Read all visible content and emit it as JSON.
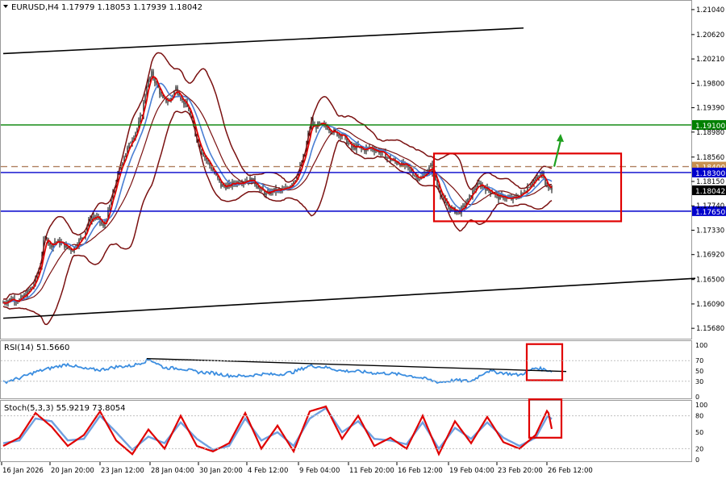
{
  "header": {
    "symbol_label": "EURUSD,H4",
    "ohlc": "1.17979 1.18053 1.17939 1.18042"
  },
  "colors": {
    "candle": "#000000",
    "bb": "#7a1010",
    "ma_fast": "#e00000",
    "ma_slow": "#4a7fd4",
    "trend": "#000000",
    "hline_blue": "#0000cc",
    "hline_green": "#008000",
    "hline_dashed": "#b08060",
    "rect": "#e00000",
    "arrow": "#1fa01f",
    "rsi": "#3c8ee0",
    "stoch_main": "#e00000",
    "stoch_signal": "#6fa0e0",
    "price_badge_bg": "#000000",
    "blue_badge_bg": "#0000cc",
    "green_badge_bg": "#008000",
    "orange_badge_bg": "#c89050"
  },
  "chart_data": [
    {
      "type": "line",
      "panel": "price",
      "title": "EURUSD,H4",
      "ylim": [
        1.1556,
        1.2112
      ],
      "y_ticks": [
        "1.21040",
        "1.20620",
        "1.20210",
        "1.19800",
        "1.19390",
        "1.18980",
        "1.18560",
        "1.18150",
        "1.17740",
        "1.17330",
        "1.16920",
        "1.16500",
        "1.16090",
        "1.15680"
      ],
      "x_labels": [
        "16 Jan 2026",
        "20 Jan 20:00",
        "23 Jan 12:00",
        "28 Jan 04:00",
        "30 Jan 20:00",
        "4 Feb 12:00",
        "9 Feb 04:00",
        "11 Feb 20:00",
        "16 Feb 12:00",
        "19 Feb 04:00",
        "23 Feb 20:00",
        "26 Feb 12:00"
      ],
      "close_anchor_x": [
        0,
        10,
        20,
        30,
        38,
        46,
        50,
        54,
        58,
        64,
        68,
        74,
        80,
        86,
        92,
        100,
        106,
        112,
        118,
        124,
        130,
        138,
        144,
        150,
        158,
        166,
        172,
        178,
        184,
        190,
        198,
        206,
        214,
        222,
        230,
        238,
        246,
        254,
        262,
        270,
        278,
        286,
        294,
        302,
        310,
        318,
        326,
        334,
        342,
        350,
        356,
        362,
        368,
        374,
        378,
        382,
        386,
        390,
        396,
        402,
        408,
        414,
        420,
        426,
        432,
        438,
        446,
        454,
        462,
        470,
        478,
        486,
        494,
        502,
        510,
        518,
        524,
        530,
        536,
        542,
        548,
        554,
        560,
        566,
        572,
        578,
        584,
        590,
        596,
        602,
        608,
        614,
        620,
        626,
        632,
        638,
        644,
        650,
        656,
        662,
        668,
        672,
        676,
        680
      ],
      "close_anchor_y": [
        1.1611,
        1.1618,
        1.1615,
        1.1628,
        1.1642,
        1.1675,
        1.1712,
        1.1722,
        1.1706,
        1.1714,
        1.1713,
        1.171,
        1.1703,
        1.17,
        1.1712,
        1.1725,
        1.1748,
        1.1756,
        1.1752,
        1.1738,
        1.1763,
        1.1805,
        1.1835,
        1.1858,
        1.1882,
        1.1904,
        1.193,
        1.1978,
        1.1996,
        1.1978,
        1.1952,
        1.195,
        1.1972,
        1.1952,
        1.1935,
        1.1895,
        1.1865,
        1.1847,
        1.1828,
        1.1808,
        1.1807,
        1.1812,
        1.1815,
        1.1818,
        1.1816,
        1.1803,
        1.1793,
        1.18,
        1.1799,
        1.1802,
        1.181,
        1.182,
        1.1838,
        1.1862,
        1.1893,
        1.1915,
        1.1905,
        1.191,
        1.1909,
        1.1906,
        1.19,
        1.1895,
        1.1895,
        1.1882,
        1.1872,
        1.1873,
        1.1868,
        1.1872,
        1.1868,
        1.1863,
        1.1853,
        1.1848,
        1.1844,
        1.1838,
        1.1826,
        1.182,
        1.183,
        1.184,
        1.1818,
        1.1795,
        1.1777,
        1.177,
        1.1765,
        1.1765,
        1.1774,
        1.1788,
        1.1802,
        1.181,
        1.1806,
        1.18,
        1.1795,
        1.1788,
        1.179,
        1.1785,
        1.1786,
        1.179,
        1.1795,
        1.1805,
        1.1815,
        1.182,
        1.1828,
        1.1812,
        1.1808,
        1.1804
      ],
      "horizontal_levels": [
        {
          "value": 1.191,
          "label": "1.19100",
          "style": "solid",
          "color": "green"
        },
        {
          "value": 1.184,
          "label": "1.18400",
          "style": "dashed",
          "color": "orange"
        },
        {
          "value": 1.183,
          "label": "1.18300",
          "style": "solid",
          "color": "blue"
        },
        {
          "value": 1.1765,
          "label": "1.17650",
          "style": "solid",
          "color": "blue"
        }
      ],
      "current_price": {
        "value": 1.18042,
        "label": "1.18042"
      },
      "trendlines": [
        {
          "from": [
            0,
            1.203
          ],
          "to": [
            645,
            1.2073
          ]
        },
        {
          "from": [
            0,
            1.1585
          ],
          "to": [
            858,
            1.1652
          ]
        }
      ],
      "annotation_box": {
        "x_from": 534,
        "x_to": 766,
        "y_from": 1.1862,
        "y_to": 1.1748
      },
      "arrow": {
        "from": [
          683,
          1.184
        ],
        "to": [
          691,
          1.1895
        ]
      }
    },
    {
      "type": "line",
      "panel": "rsi",
      "title": "RSI(14) 51.5660",
      "ylim": [
        0,
        100
      ],
      "y_ticks": [
        "100",
        "70",
        "50",
        "30",
        "0"
      ],
      "anchor_x": [
        0,
        20,
        40,
        60,
        80,
        100,
        120,
        140,
        160,
        182,
        200,
        220,
        240,
        260,
        280,
        300,
        320,
        340,
        360,
        380,
        400,
        420,
        440,
        460,
        480,
        500,
        520,
        540,
        560,
        580,
        600,
        620,
        640,
        660,
        680
      ],
      "anchor_y": [
        28,
        36,
        48,
        56,
        63,
        54,
        52,
        58,
        60,
        72,
        56,
        55,
        48,
        46,
        41,
        40,
        44,
        43,
        48,
        60,
        57,
        50,
        49,
        46,
        45,
        42,
        36,
        28,
        32,
        30,
        50,
        46,
        42,
        56,
        50
      ],
      "trendline": {
        "from": [
          178,
          74
        ],
        "to": [
          698,
          49
        ]
      },
      "annotation_box": {
        "x_from": 649,
        "x_to": 693,
        "y_from": 102,
        "y_to": 32
      }
    },
    {
      "type": "line",
      "panel": "stoch",
      "title": "Stoch(5,3,3) 55.9219 73.8054",
      "ylim": [
        0,
        100
      ],
      "y_ticks": [
        "100",
        "80",
        "50",
        "20",
        "0"
      ],
      "main_anchor_x": [
        0,
        20,
        40,
        60,
        80,
        100,
        120,
        140,
        160,
        180,
        200,
        220,
        240,
        260,
        280,
        300,
        320,
        340,
        360,
        380,
        400,
        420,
        440,
        460,
        480,
        500,
        520,
        540,
        560,
        580,
        600,
        620,
        640,
        660,
        675,
        680
      ],
      "main_anchor_y": [
        25,
        40,
        85,
        60,
        25,
        45,
        88,
        35,
        10,
        55,
        20,
        80,
        25,
        15,
        30,
        85,
        20,
        62,
        15,
        88,
        97,
        38,
        80,
        25,
        40,
        20,
        80,
        10,
        70,
        30,
        78,
        32,
        20,
        45,
        92,
        56
      ],
      "signal_anchor_x": [
        0,
        20,
        40,
        60,
        80,
        100,
        120,
        140,
        160,
        180,
        200,
        220,
        240,
        260,
        280,
        300,
        320,
        340,
        360,
        380,
        400,
        420,
        440,
        460,
        480,
        500,
        520,
        540,
        560,
        580,
        600,
        620,
        640,
        660,
        675,
        680
      ],
      "signal_anchor_y": [
        30,
        35,
        75,
        70,
        35,
        38,
        80,
        50,
        18,
        42,
        30,
        68,
        38,
        18,
        25,
        75,
        35,
        50,
        25,
        75,
        94,
        50,
        70,
        38,
        35,
        28,
        68,
        20,
        58,
        38,
        68,
        40,
        25,
        40,
        80,
        74
      ],
      "annotation_box": {
        "x_from": 652,
        "x_to": 692,
        "y_from": 110,
        "y_to": 40
      }
    }
  ]
}
